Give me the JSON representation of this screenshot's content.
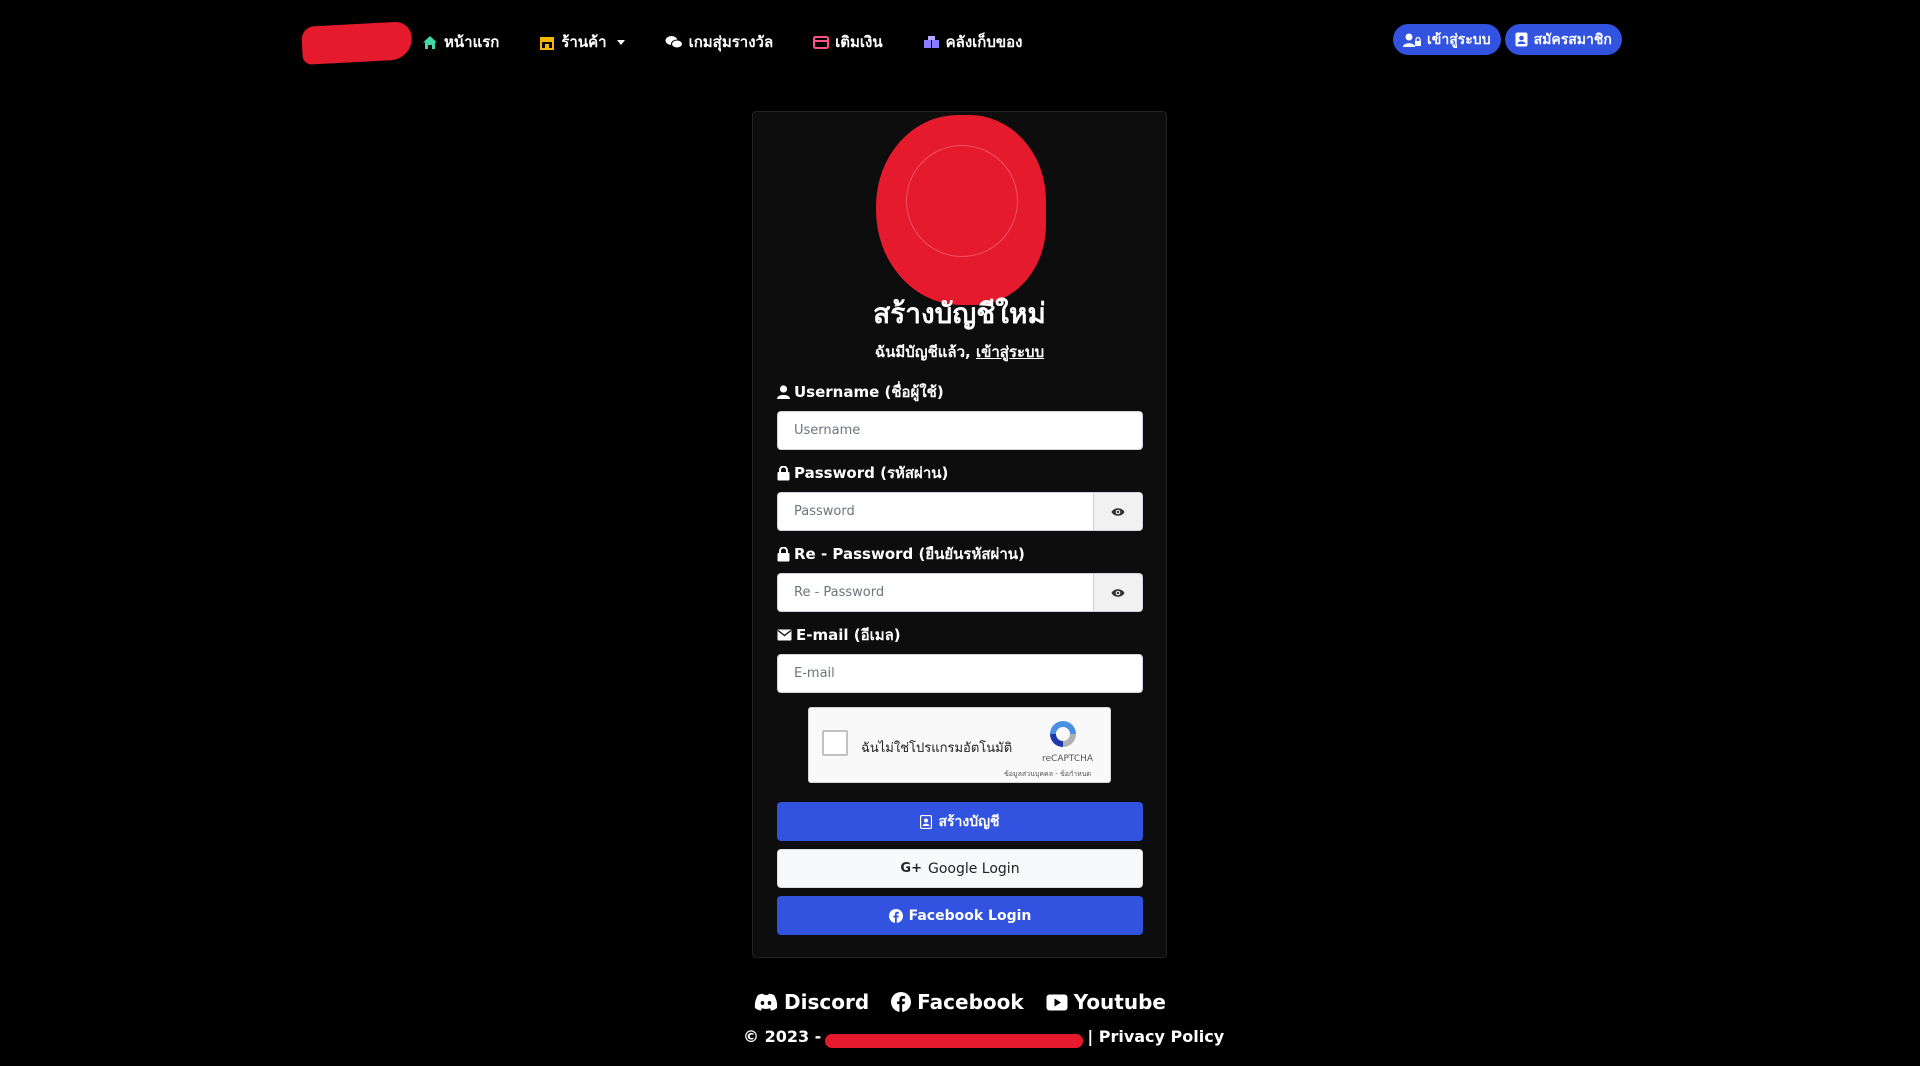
{
  "nav": {
    "links": [
      {
        "label": "หน้าแรก",
        "icon": "home-icon",
        "color": "#3fd9a3"
      },
      {
        "label": "ร้านค้า",
        "icon": "shop-icon",
        "color": "#f5b800"
      },
      {
        "label": "เกมสุ่มรางวัล",
        "icon": "chat-bubbles-icon",
        "color": "#ffffff"
      },
      {
        "label": "เติมเงิน",
        "icon": "credit-card-icon",
        "color": "#ff4f8b"
      },
      {
        "label": "คลังเก็บของ",
        "icon": "boxes-icon",
        "color": "#8a7bff"
      }
    ],
    "login_label": "เข้าสู่ระบบ",
    "register_label": "สมัครสมาชิก"
  },
  "card": {
    "title": "สร้างบัญชีใหม่",
    "subtitle_prefix": "ฉันมีบัญชีแล้ว,",
    "subtitle_link": "เข้าสู่ระบบ",
    "fields": {
      "username_label": "Username (ชื่อผู้ใช้)",
      "username_placeholder": "Username",
      "password_label": "Password (รหัสผ่าน)",
      "password_placeholder": "Password",
      "repassword_label": "Re - Password (ยืนยันรหัสผ่าน)",
      "repassword_placeholder": "Re - Password",
      "email_label": "E-mail (อีเมล)",
      "email_placeholder": "E-mail"
    },
    "captcha": {
      "text": "ฉันไม่ใช่โปรแกรมอัตโนมัติ",
      "brand": "reCAPTCHA",
      "links": "ข้อมูลส่วนบุคคล - ข้อกำหนด"
    },
    "buttons": {
      "create": "สร้างบัญชี",
      "google": "Google Login",
      "facebook": "Facebook Login"
    }
  },
  "footer": {
    "social": [
      "Discord",
      "Facebook",
      "Youtube"
    ],
    "copyright": "© 2023 -",
    "privacy": "| Privacy Policy"
  },
  "colors": {
    "accent": "#3252e0",
    "redaction": "#e51a2c",
    "background": "#000000",
    "card": "#0d0d0d"
  }
}
